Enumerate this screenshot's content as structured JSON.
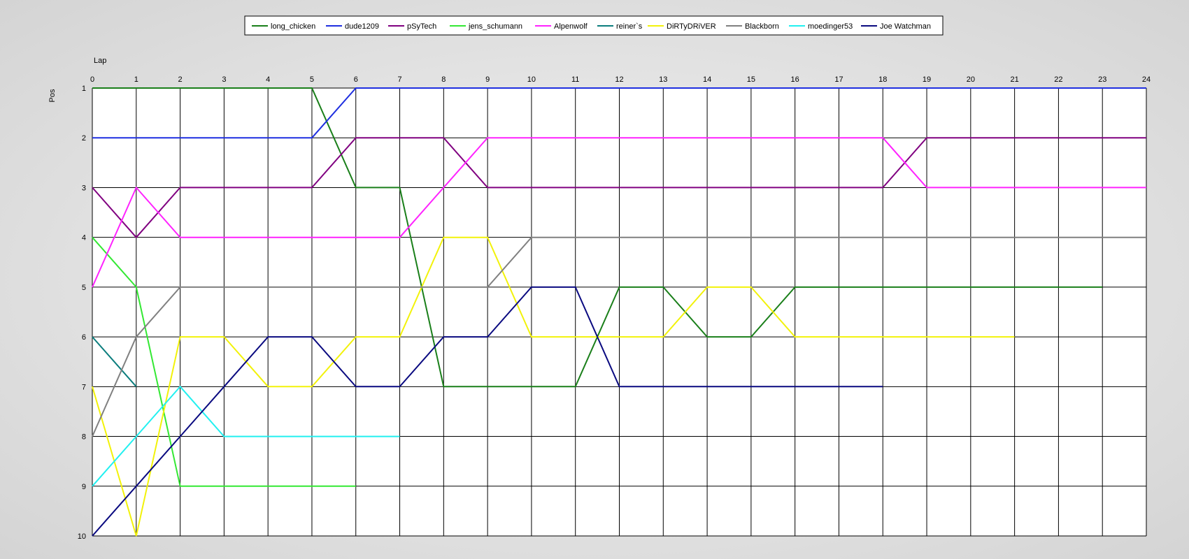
{
  "chart_data": {
    "type": "line",
    "xlabel": "Lap",
    "ylabel": "Pos",
    "xlim": [
      0,
      24
    ],
    "ylim": [
      1,
      10
    ],
    "y_inverted": true,
    "grid": true,
    "legend_position": "top-center",
    "x_ticks": [
      0,
      1,
      2,
      3,
      4,
      5,
      6,
      7,
      8,
      9,
      10,
      11,
      12,
      13,
      14,
      15,
      16,
      17,
      18,
      19,
      20,
      21,
      22,
      23,
      24
    ],
    "y_ticks": [
      1,
      2,
      3,
      4,
      5,
      6,
      7,
      8,
      9,
      10
    ],
    "series": [
      {
        "name": "long_chicken",
        "color": "#1a7f1a",
        "x": [
          0,
          1,
          2,
          3,
          4,
          5,
          6,
          7,
          8,
          9,
          10,
          11,
          12,
          13,
          14,
          15,
          16,
          17,
          18,
          19,
          20,
          21,
          22,
          23
        ],
        "y": [
          1,
          1,
          1,
          1,
          1,
          1,
          3,
          3,
          7,
          7,
          7,
          7,
          5,
          5,
          6,
          6,
          5,
          5,
          5,
          5,
          5,
          5,
          5,
          5
        ]
      },
      {
        "name": "dude1209",
        "color": "#1f2fe0",
        "x": [
          0,
          1,
          2,
          3,
          4,
          5,
          6,
          7,
          8,
          9,
          10,
          11,
          12,
          13,
          14,
          15,
          16,
          17,
          18,
          19,
          20,
          21,
          22,
          23,
          24
        ],
        "y": [
          2,
          2,
          2,
          2,
          2,
          2,
          1,
          1,
          1,
          1,
          1,
          1,
          1,
          1,
          1,
          1,
          1,
          1,
          1,
          1,
          1,
          1,
          1,
          1,
          1
        ]
      },
      {
        "name": "pSyTech",
        "color": "#800080",
        "x": [
          0,
          1,
          2,
          3,
          4,
          5,
          6,
          7,
          8,
          9,
          10,
          11,
          12,
          13,
          14,
          15,
          16,
          17,
          18,
          19,
          20,
          21,
          22,
          23,
          24
        ],
        "y": [
          3,
          4,
          3,
          3,
          3,
          3,
          2,
          2,
          2,
          3,
          3,
          3,
          3,
          3,
          3,
          3,
          3,
          3,
          3,
          2,
          2,
          2,
          2,
          2,
          2
        ]
      },
      {
        "name": "jens_schumann",
        "color": "#33e833",
        "x": [
          0,
          1,
          2,
          3,
          4,
          5,
          6
        ],
        "y": [
          4,
          5,
          9,
          9,
          9,
          9,
          9
        ]
      },
      {
        "name": "Alpenwolf",
        "color": "#ff22ff",
        "x": [
          0,
          1,
          2,
          3,
          4,
          5,
          6,
          7,
          8,
          9,
          10,
          11,
          12,
          13,
          14,
          15,
          16,
          17,
          18,
          19,
          20,
          21,
          22,
          23,
          24
        ],
        "y": [
          5,
          3,
          4,
          4,
          4,
          4,
          4,
          4,
          3,
          2,
          2,
          2,
          2,
          2,
          2,
          2,
          2,
          2,
          2,
          3,
          3,
          3,
          3,
          3,
          3
        ]
      },
      {
        "name": "reiner`s",
        "color": "#0b7d7d",
        "x": [
          0,
          1
        ],
        "y": [
          6,
          7
        ]
      },
      {
        "name": "DiRTyDRiVER",
        "color": "#f2f20a",
        "x": [
          0,
          1,
          2,
          3,
          4,
          5,
          6,
          7,
          8,
          9,
          10,
          11,
          12,
          13,
          14,
          15,
          16,
          17,
          18,
          19,
          20,
          21
        ],
        "y": [
          7,
          10,
          6,
          6,
          7,
          7,
          6,
          6,
          4,
          4,
          6,
          6,
          6,
          6,
          5,
          5,
          6,
          6,
          6,
          6,
          6,
          6
        ]
      },
      {
        "name": "Blackborn",
        "color": "#808080",
        "x": [
          0,
          1,
          2,
          3,
          4,
          5,
          6,
          7,
          8,
          9,
          10,
          11,
          12,
          13,
          14,
          15,
          16,
          17,
          18,
          19,
          20,
          21,
          22,
          23,
          24
        ],
        "y": [
          8,
          6,
          5,
          5,
          5,
          5,
          5,
          5,
          5,
          5,
          4,
          4,
          4,
          4,
          4,
          4,
          4,
          4,
          4,
          4,
          4,
          4,
          4,
          4,
          4
        ]
      },
      {
        "name": "moedinger53",
        "color": "#22f0f0",
        "x": [
          0,
          1,
          2,
          3,
          4,
          5,
          6,
          7
        ],
        "y": [
          9,
          8,
          7,
          8,
          8,
          8,
          8,
          8
        ]
      },
      {
        "name": "Joe Watchman",
        "color": "#0a0a80",
        "x": [
          0,
          1,
          2,
          3,
          4,
          5,
          6,
          7,
          8,
          9,
          10,
          11,
          12,
          13,
          14,
          15,
          16,
          17,
          18
        ],
        "y": [
          10,
          9,
          8,
          7,
          6,
          6,
          7,
          7,
          6,
          6,
          5,
          5,
          7,
          7,
          7,
          7,
          7,
          7,
          7
        ]
      }
    ]
  }
}
